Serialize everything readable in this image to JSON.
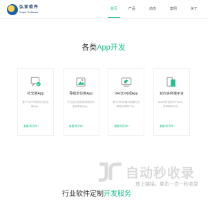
{
  "header": {
    "logo_cn": "弘亚软件",
    "logo_en": "Super Software",
    "nav": [
      {
        "label": "首页",
        "active": true
      },
      {
        "label": "产品",
        "active": false
      },
      {
        "label": "动态",
        "active": false
      },
      {
        "label": "案例",
        "active": false
      },
      {
        "label": "关于",
        "active": false
      }
    ]
  },
  "services": {
    "title_prefix": "各类",
    "title_accent": "App开发",
    "cards": [
      {
        "icon": "social-app-icon",
        "title": "社交类App",
        "desc": "基于HAPP提供社交社区类App。",
        "link": "查看/知识库"
      },
      {
        "icon": "tourism-app-icon",
        "title": "导航定位类App",
        "desc": "专业定位导航提供服务的旅游等类App。",
        "link": "查看/知识库"
      },
      {
        "icon": "vr-app-icon",
        "title": "VR/3D可视App",
        "desc": "基于VR/3D展示图像与全景等互联网产品。",
        "link": "查看/知识库"
      },
      {
        "icon": "cross-platform-icon",
        "title": "双向多终端平台",
        "desc": "App同时适用于iPhone、安卓等各平台。",
        "link": "查看/知识库"
      }
    ],
    "accent_color": "#1fbf8f"
  },
  "next_section": {
    "title_prefix": "行业软件定制",
    "title_accent": "开发服务"
  },
  "watermark": {
    "big": "自动秒收录",
    "small": "放上链接，单击一次一秒收录"
  }
}
